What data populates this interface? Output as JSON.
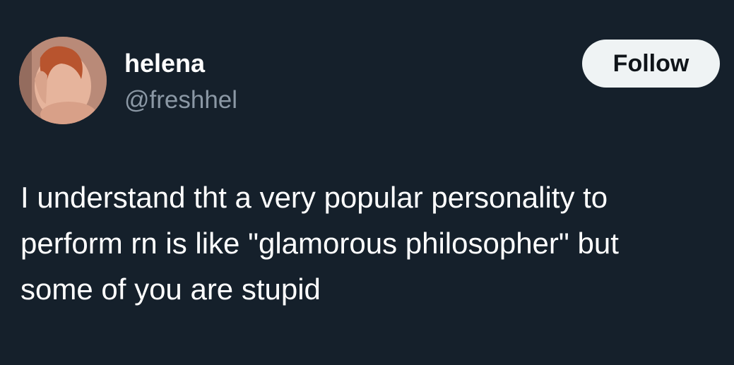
{
  "author": {
    "display_name": "helena",
    "handle": "@freshhel",
    "avatar_icon": "profile-photo"
  },
  "actions": {
    "follow_label": "Follow"
  },
  "tweet": {
    "text": "I understand tht a very popular personality to\nperform rn is like \"glamorous philosopher\" but\nsome of you are stupid"
  },
  "colors": {
    "background": "#15202b",
    "primary_text": "#ffffff",
    "secondary_text": "#8b98a5",
    "button_bg": "#eff3f4",
    "button_text": "#0f1419"
  }
}
